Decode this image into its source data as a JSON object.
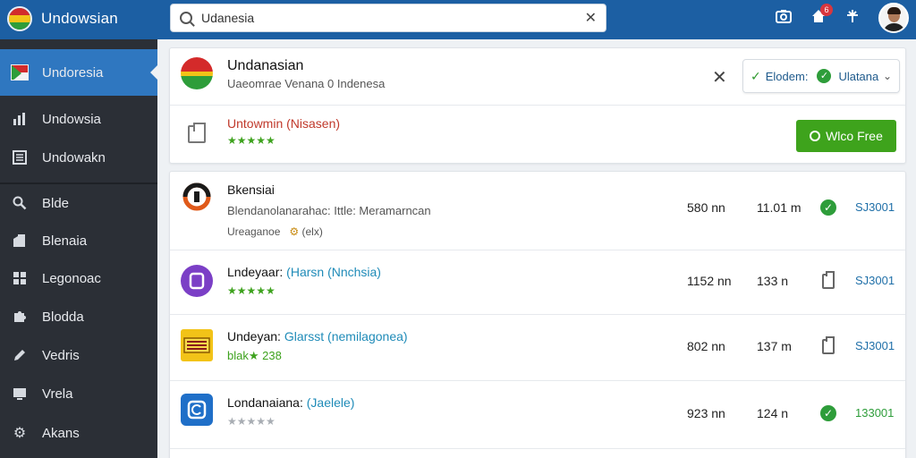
{
  "app": {
    "title": "Undowsian"
  },
  "search": {
    "value": "Udanesia",
    "clear_label": "✕"
  },
  "topbar": {
    "notification_count": "6"
  },
  "sidebar": {
    "items": [
      {
        "label": "Undoresia",
        "icon": "flag-icon"
      },
      {
        "label": "Undowsia",
        "icon": "chart-bar-icon"
      },
      {
        "label": "Undowakn",
        "icon": "calculator-icon"
      },
      {
        "label": "Blde",
        "icon": "search-icon"
      },
      {
        "label": "Blenaia",
        "icon": "building-icon"
      },
      {
        "label": "Legonoac",
        "icon": "grid-icon"
      },
      {
        "label": "Blodda",
        "icon": "puzzle-icon"
      },
      {
        "label": "Vedris",
        "icon": "pencil-icon"
      },
      {
        "label": "Vrela",
        "icon": "monitor-icon"
      },
      {
        "label": "Akans",
        "icon": "gear-icon"
      }
    ]
  },
  "header": {
    "title": "Undanasian",
    "subtitle": "Uaeomrae Venana 0 Indenesa",
    "status_label": "Elodem:",
    "status_value": "Ulatana",
    "link_text": "Untowmin (Nisasen)",
    "stars": "★★★★★",
    "primary_button": "Wlco Free"
  },
  "list": [
    {
      "title": "Bkensiai",
      "subtitle": "Blendanolanarahac: Ittle: Meramarncan",
      "meta_label": "Ureaganoe",
      "meta_tag": "(elx)",
      "size": "580 nn",
      "time": "11.01 m",
      "status": "check",
      "code": "SJ3001"
    },
    {
      "title": "Lndeyaar:",
      "tag": "(Harsn (Nnchsia)",
      "stars": "★★★★★",
      "size": "1152 nn",
      "time": "133 n",
      "status": "doc",
      "code": "SJ3001"
    },
    {
      "title": "Undeyan:",
      "tag": "Glarsst (nemilagonea)",
      "stars_text": "blak★ 238",
      "size": "802 nn",
      "time": "137 m",
      "status": "doc",
      "code": "SJ3001"
    },
    {
      "title": "Londanaiana:",
      "tag": "(Jaelele)",
      "stars": "★★★★★",
      "size": "923 nn",
      "time": "124 n",
      "status": "check",
      "code": "133001"
    }
  ],
  "colors": {
    "topbar": "#1c5fa3",
    "sidebar": "#2b2f36",
    "sidebar_active": "#2f77c0",
    "accent_green": "#3ea31c",
    "link_red": "#c0392b",
    "tag_blue": "#1f8bb8"
  }
}
